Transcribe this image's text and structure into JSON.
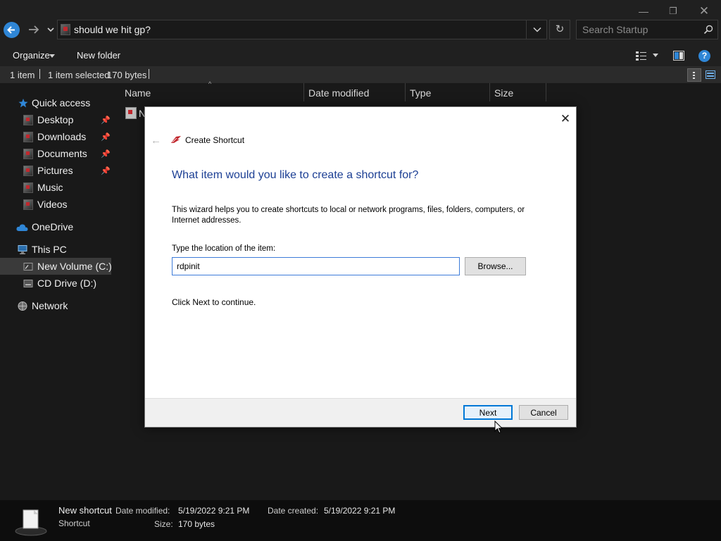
{
  "window": {
    "controls": {
      "minimize": "—",
      "maximize": "❐",
      "close": "✕"
    },
    "address_path": "should we hit gp?",
    "refresh_glyph": "↻",
    "search_placeholder": "Search Startup"
  },
  "toolbar": {
    "organize_label": "Organize",
    "new_folder_label": "New folder"
  },
  "status": {
    "item_count": "1 item",
    "selected": "1 item selected",
    "selected_size": "170 bytes"
  },
  "nav": {
    "quick_access": "Quick access",
    "items": [
      {
        "label": "Desktop",
        "pinned": true
      },
      {
        "label": "Downloads",
        "pinned": true
      },
      {
        "label": "Documents",
        "pinned": true
      },
      {
        "label": "Pictures",
        "pinned": true
      },
      {
        "label": "Music",
        "pinned": false
      },
      {
        "label": "Videos",
        "pinned": false
      }
    ],
    "onedrive": "OneDrive",
    "this_pc": "This PC",
    "new_volume": "New Volume (C:)",
    "cd_drive": "CD Drive (D:)",
    "network": "Network",
    "pin_glyph": "📌"
  },
  "file_list": {
    "columns": [
      "Name",
      "Date modified",
      "Type",
      "Size"
    ],
    "sort_arrow": "^",
    "rows": [
      {
        "name_visible": "N"
      }
    ]
  },
  "details": {
    "name": "New shortcut",
    "type": "Shortcut",
    "date_modified_label": "Date modified:",
    "date_modified": "5/19/2022 9:21 PM",
    "size_label": "Size:",
    "size": "170 bytes",
    "date_created_label": "Date created:",
    "date_created": "5/19/2022 9:21 PM"
  },
  "dialog": {
    "close_glyph": "✕",
    "back_glyph": "←",
    "title": "Create Shortcut",
    "heading": "What item would you like to create a shortcut for?",
    "description": "This wizard helps you to create shortcuts to local or network programs, files, folders, computers, or Internet addresses.",
    "location_label": "Type the location of the item:",
    "location_value": "rdpinit",
    "browse_label": "Browse...",
    "continue_text": "Click Next to continue.",
    "next_label": "Next",
    "cancel_label": "Cancel"
  },
  "colors": {
    "accent_blue": "#2f86d6",
    "heading_blue": "#1c3f94",
    "brand_red": "#c1272d",
    "dark_bg": "#191919"
  }
}
